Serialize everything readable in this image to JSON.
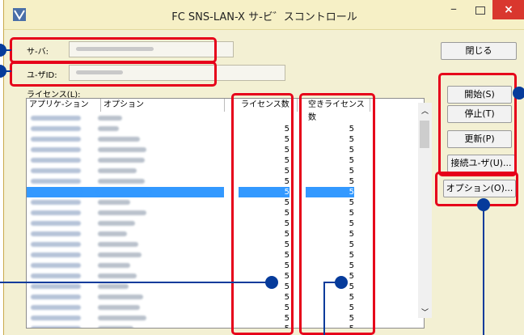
{
  "window": {
    "title": "FC SNS-LAN-X サ-ビ゛スコントロール",
    "minimize": "–",
    "close": "×"
  },
  "fields": {
    "server_label": "サ-バ:",
    "user_label": "ユ-ザID:",
    "license_label": "ライセンス(L):"
  },
  "buttons": {
    "close": "閉じる",
    "start": "開始(S)",
    "stop": "停止(T)",
    "update": "更新(P)",
    "connected_users": "接続ユ-ザ(U)...",
    "options": "オプション(O)..."
  },
  "list": {
    "headers": [
      "アプリケ-ション",
      "オプション",
      "ライセンス数",
      "空きライセンス数"
    ],
    "rows": [
      {
        "licenses": "",
        "free": ""
      },
      {
        "licenses": "5",
        "free": "5"
      },
      {
        "licenses": "5",
        "free": "5"
      },
      {
        "licenses": "5",
        "free": "5"
      },
      {
        "licenses": "5",
        "free": "5"
      },
      {
        "licenses": "5",
        "free": "5"
      },
      {
        "licenses": "5",
        "free": "5"
      },
      {
        "licenses": "5",
        "free": "5",
        "selected": true
      },
      {
        "licenses": "5",
        "free": "5"
      },
      {
        "licenses": "5",
        "free": "5"
      },
      {
        "licenses": "5",
        "free": "5"
      },
      {
        "licenses": "5",
        "free": "5"
      },
      {
        "licenses": "5",
        "free": "5"
      },
      {
        "licenses": "5",
        "free": "5"
      },
      {
        "licenses": "5",
        "free": "5"
      },
      {
        "licenses": "5",
        "free": "5"
      },
      {
        "licenses": "5",
        "free": "5"
      },
      {
        "licenses": "5",
        "free": "5"
      },
      {
        "licenses": "5",
        "free": "5"
      },
      {
        "licenses": "5",
        "free": "5"
      },
      {
        "licenses": "5",
        "free": "5"
      }
    ]
  },
  "colors": {
    "highlight_red": "#e6001a",
    "callout_blue": "#063b9b",
    "selection": "#3399ff"
  }
}
